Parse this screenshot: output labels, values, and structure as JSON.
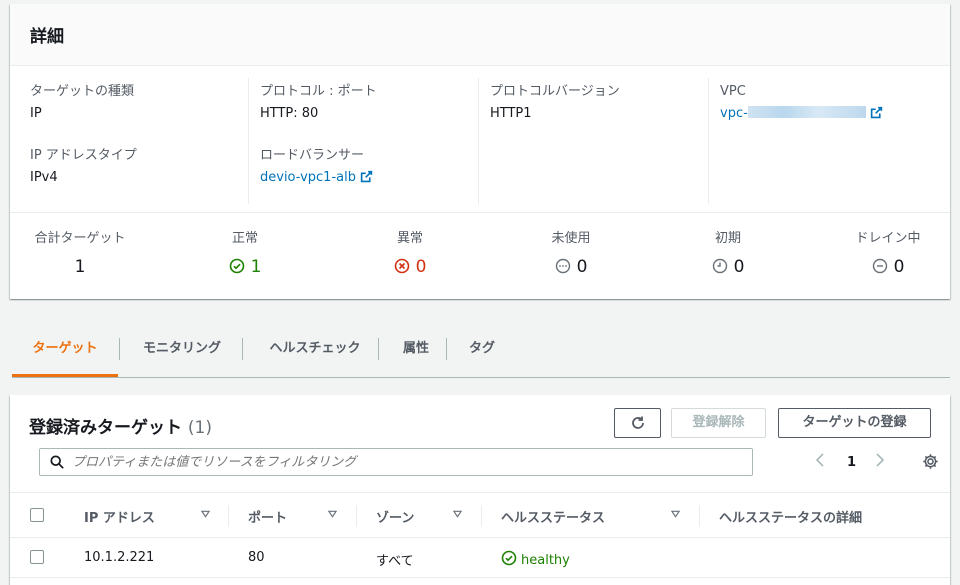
{
  "details": {
    "title": "詳細",
    "target_type": {
      "label": "ターゲットの種類",
      "value": "IP"
    },
    "ip_address_type": {
      "label": "IP アドレスタイプ",
      "value": "IPv4"
    },
    "protocol_port": {
      "label": "プロトコル : ポート",
      "value": "HTTP: 80"
    },
    "load_balancer": {
      "label": "ロードバランサー",
      "value": "devio-vpc1-alb"
    },
    "protocol_version": {
      "label": "プロトコルバージョン",
      "value": "HTTP1"
    },
    "vpc": {
      "label": "VPC",
      "value": "vpc-"
    }
  },
  "summary": {
    "total": {
      "label": "合計ターゲット",
      "value": "1"
    },
    "healthy": {
      "label": "正常",
      "value": "1",
      "color": "#1d8102"
    },
    "unhealthy": {
      "label": "異常",
      "value": "0",
      "color": "#d13212"
    },
    "unused": {
      "label": "未使用",
      "value": "0",
      "color": "#687078"
    },
    "initial": {
      "label": "初期",
      "value": "0",
      "color": "#687078"
    },
    "draining": {
      "label": "ドレイン中",
      "value": "0",
      "color": "#687078"
    }
  },
  "tabs": [
    {
      "label": "ターゲット",
      "active": true
    },
    {
      "label": "モニタリング"
    },
    {
      "label": "ヘルスチェック"
    },
    {
      "label": "属性"
    },
    {
      "label": "タグ"
    }
  ],
  "targets": {
    "title": "登録済みターゲット",
    "count": "(1)",
    "deregister_label": "登録解除",
    "register_label": "ターゲットの登録",
    "search_placeholder": "プロパティまたは値でリソースをフィルタリング",
    "page": "1",
    "columns": [
      "IP アドレス",
      "ポート",
      "ゾーン",
      "ヘルスステータス",
      "ヘルスステータスの詳細"
    ],
    "rows": [
      {
        "ip": "10.1.2.221",
        "port": "80",
        "zone": "すべて",
        "health": "healthy",
        "health_detail": ""
      }
    ]
  },
  "colors": {
    "accent": "#ec7211",
    "link": "#0073bb"
  }
}
